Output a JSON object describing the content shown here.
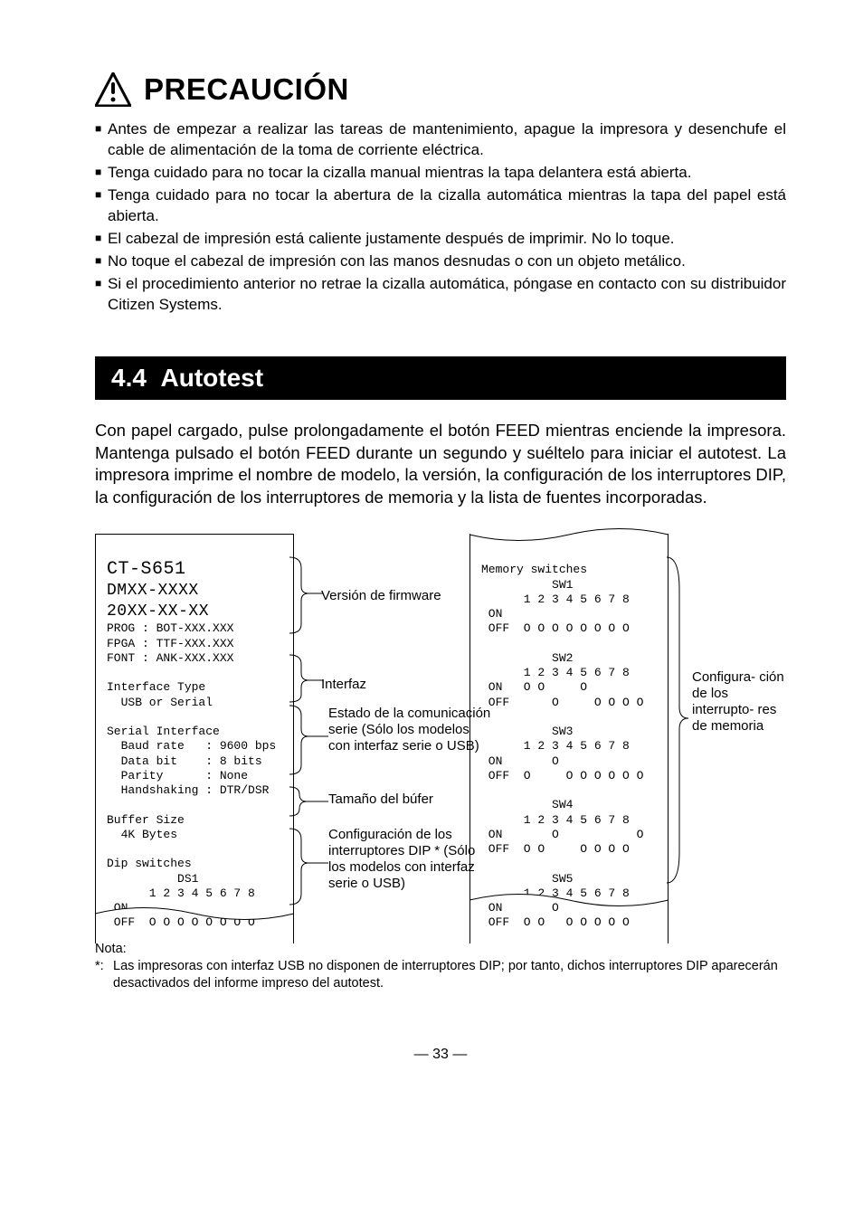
{
  "caution": {
    "title": "PRECAUCIÓN",
    "items": [
      "Antes de empezar a realizar las tareas de mantenimiento, apague la impresora y desenchufe el cable de alimentación de la toma de corriente eléctrica.",
      "Tenga cuidado para no tocar la cizalla manual mientras la tapa delantera está abierta.",
      "Tenga cuidado para no tocar la abertura de la cizalla automática mientras la tapa del papel está abierta.",
      "El cabezal de impresión está caliente justamente después de imprimir. No lo toque.",
      "No toque el cabezal de impresión con las manos desnudas o con un objeto metálico.",
      "Si el procedimiento anterior no retrae la cizalla automática, póngase en contacto con su distribuidor Citizen Systems."
    ]
  },
  "section": {
    "number": "4.4",
    "title": "Autotest",
    "intro": "Con papel cargado, pulse prolongadamente el botón FEED mientras enciende la impresora. Mantenga pulsado el botón FEED durante un segundo y suéltelo para iniciar el autotest. La impresora imprime el nombre de modelo, la versión, la configuración de los interruptores DIP, la configuración de los interruptores de memoria y la lista de fuentes incorporadas."
  },
  "annotations": {
    "firmware": "Versión de firmware",
    "interfaz": "Interfaz",
    "estado": "Estado de la comunicación serie (Sólo los modelos con interfaz serie o USB)",
    "bufer": "Tamaño del búfer",
    "dip": "Configuración de los interruptores DIP * (Sólo los modelos con interfaz serie o USB)",
    "memoria": "Configura-\nción de los interrupto-\nres de memoria"
  },
  "receipt_left": {
    "model": "CT-S651",
    "serial": "DMXX-XXXX",
    "date": "20XX-XX-XX",
    "prog": "PROG : BOT-XXX.XXX",
    "fpga": "FPGA : TTF-XXX.XXX",
    "font": "FONT : ANK-XXX.XXX",
    "iface_title": "Interface Type",
    "iface_val": "  USB or Serial",
    "ser_title": "Serial Interface",
    "baud": "  Baud rate   : 9600 bps",
    "databit": "  Data bit    : 8 bits",
    "parity": "  Parity      : None",
    "handshake": "  Handshaking : DTR/DSR",
    "buf_title": "Buffer Size",
    "buf_val": "  4K Bytes",
    "dip_title": "Dip switches",
    "ds1": "          DS1",
    "cols": "      1 2 3 4 5 6 7 8",
    "on": " ON",
    "off": " OFF  O O O O O O O O"
  },
  "receipt_right": {
    "title": "Memory switches",
    "sw1": "          SW1",
    "cols": "      1 2 3 4 5 6 7 8",
    "on": " ON",
    "off1": " OFF  O O O O O O O O",
    "sw2": "          SW2",
    "on2": " ON   O O     O",
    "off2": " OFF      O     O O O O",
    "sw3": "          SW3",
    "on3": " ON       O",
    "off3": " OFF  O     O O O O O O",
    "sw4": "          SW4",
    "on4": " ON       O           O",
    "off4": " OFF  O O     O O O O",
    "sw5": "          SW5",
    "on5": " ON       O",
    "off5": " OFF  O O   O O O O O"
  },
  "note": {
    "label": "Nota:",
    "marker": "*:",
    "text": "Las impresoras con interfaz USB no disponen de interruptores DIP; por tanto, dichos interruptores DIP aparecerán desactivados del informe impreso del autotest."
  },
  "pagenum": "— 33 —"
}
